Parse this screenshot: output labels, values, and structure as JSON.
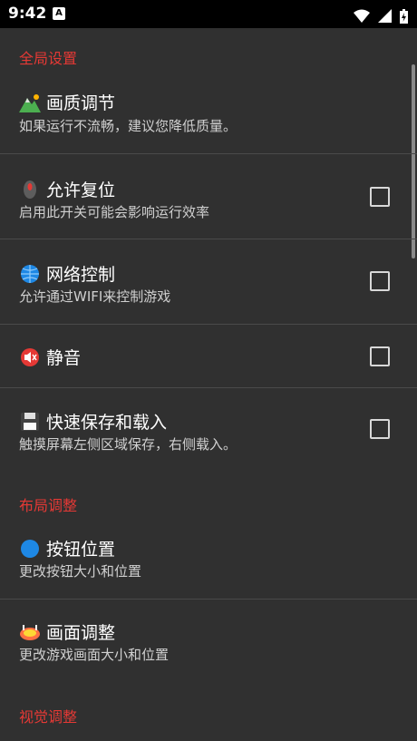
{
  "status_bar": {
    "time": "9:42",
    "notification_letter": "A",
    "icons": [
      "wifi-icon",
      "signal-icon",
      "battery-charging-icon"
    ]
  },
  "sections": {
    "global": "全局设置",
    "layout": "布局调整",
    "visual": "视觉调整"
  },
  "prefs": {
    "quality": {
      "title": "画质调节",
      "summary": "如果运行不流畅，建议您降低质量。",
      "icon": "mountain-icon"
    },
    "reset": {
      "title": "允许复位",
      "summary": "启用此开关可能会影响运行效率",
      "icon": "mouse-icon",
      "checked": false
    },
    "network": {
      "title": "网络控制",
      "summary": "允许通过WIFI来控制游戏",
      "icon": "globe-icon",
      "checked": false
    },
    "mute": {
      "title": "静音",
      "icon": "muted-speaker-icon",
      "checked": false
    },
    "quicksave": {
      "title": "快速保存和载入",
      "summary": "触摸屏幕左侧区域保存，右侧载入。",
      "icon": "floppy-disk-icon",
      "checked": false
    },
    "buttons": {
      "title": "按钮位置",
      "summary": "更改按钮大小和位置",
      "icon": "blue-circle-icon"
    },
    "screen": {
      "title": "画面调整",
      "summary": "更改游戏画面大小和位置",
      "icon": "stadium-icon"
    }
  }
}
